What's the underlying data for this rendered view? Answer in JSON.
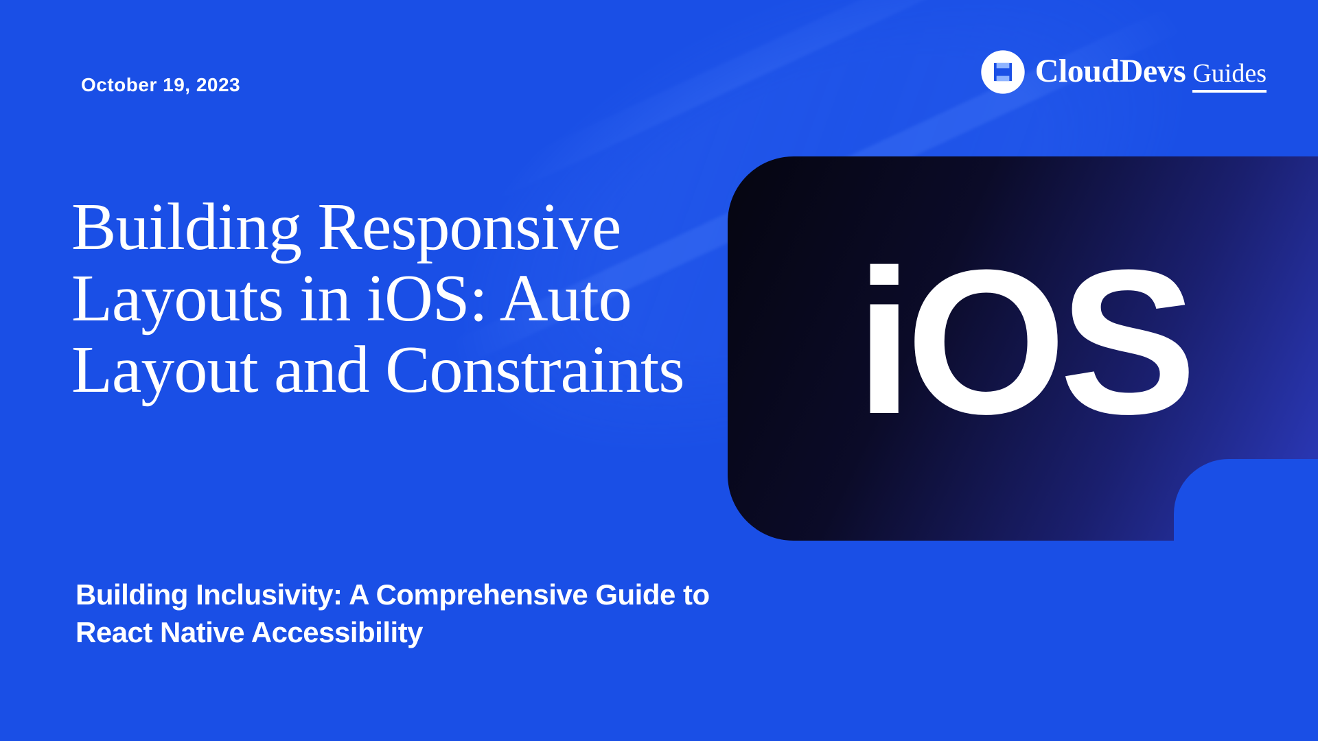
{
  "date": "October 19, 2023",
  "brand": {
    "main": "CloudDevs",
    "sub": "Guides"
  },
  "title": "Building Responsive Layouts in iOS: Auto Layout and Constraints",
  "subtitle": "Building Inclusivity: A Comprehensive Guide to React Native Accessibility",
  "badge_text": "iOS"
}
